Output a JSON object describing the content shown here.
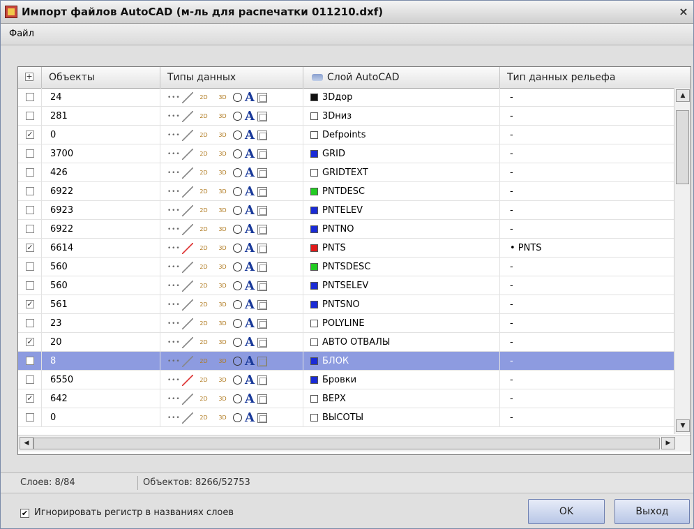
{
  "window": {
    "title": "Импорт файлов AutoCAD (м-ль для распечатки 011210.dxf)",
    "close_label": "×"
  },
  "menu": {
    "file": "Файл"
  },
  "grid": {
    "headers": {
      "check": "",
      "objects": "Объекты",
      "types": "Типы данных",
      "layer": "Слой AutoCAD",
      "terrain": "Тип данных рельефа"
    },
    "rows": [
      {
        "checked": false,
        "objects": "24",
        "layer": "3Dдор",
        "color": "#111111",
        "terrain": "-"
      },
      {
        "checked": false,
        "objects": "281",
        "layer": "3Dниз",
        "color": "#ffffff",
        "terrain": "-"
      },
      {
        "checked": true,
        "objects": "0",
        "layer": "Defpoints",
        "color": "#ffffff",
        "terrain": "-"
      },
      {
        "checked": false,
        "objects": "3700",
        "layer": "GRID",
        "color": "#1a2bd6",
        "terrain": "-"
      },
      {
        "checked": false,
        "objects": "426",
        "layer": "GRIDTEXT",
        "color": "#ffffff",
        "terrain": "-"
      },
      {
        "checked": false,
        "objects": "6922",
        "layer": "PNTDESC",
        "color": "#22cc22",
        "terrain": "-"
      },
      {
        "checked": false,
        "objects": "6923",
        "layer": "PNTELEV",
        "color": "#1a2bd6",
        "terrain": "-"
      },
      {
        "checked": false,
        "objects": "6922",
        "layer": "PNTNO",
        "color": "#1a2bd6",
        "terrain": "-"
      },
      {
        "checked": true,
        "objects": "6614",
        "layer": "PNTS",
        "color": "#e01a1a",
        "terrain": "•  PNTS"
      },
      {
        "checked": false,
        "objects": "560",
        "layer": "PNTSDESC",
        "color": "#22cc22",
        "terrain": "-"
      },
      {
        "checked": false,
        "objects": "560",
        "layer": "PNTSELEV",
        "color": "#1a2bd6",
        "terrain": "-"
      },
      {
        "checked": true,
        "objects": "561",
        "layer": "PNTSNO",
        "color": "#1a2bd6",
        "terrain": "-"
      },
      {
        "checked": false,
        "objects": "23",
        "layer": "POLYLINE",
        "color": "#ffffff",
        "terrain": "-"
      },
      {
        "checked": true,
        "objects": "20",
        "layer": "АВТО ОТВАЛЫ",
        "color": "#ffffff",
        "terrain": "-"
      },
      {
        "checked": false,
        "objects": "8",
        "layer": "БЛОК",
        "color": "#1a2bd6",
        "terrain": "-",
        "selected": true
      },
      {
        "checked": false,
        "objects": "6550",
        "layer": "Бровки",
        "color": "#1a2bd6",
        "terrain": "-"
      },
      {
        "checked": true,
        "objects": "642",
        "layer": "ВЕРХ",
        "color": "#ffffff",
        "terrain": "-"
      },
      {
        "checked": false,
        "objects": "0",
        "layer": "ВЫСОТЫ",
        "color": "#ffffff",
        "terrain": "-"
      }
    ],
    "type_icons": [
      "points-icon",
      "line-icon",
      "2d-polyline-icon",
      "3d-polyline-icon",
      "circle-icon",
      "text-icon",
      "block-icon"
    ],
    "type_2d_label": "2D",
    "type_3d_label": "3D",
    "type_text_glyph": "A"
  },
  "status": {
    "layers": "Слоев: 8/84",
    "objects": "Объектов: 8266/52753"
  },
  "footer": {
    "ignore_case_checked": true,
    "ignore_case_label": "Игнорировать регистр  в названиях слоев",
    "ok": "OK",
    "exit": "Выход"
  },
  "colors": {
    "selection": "#8d9be0",
    "button": "#b8c6e6"
  }
}
